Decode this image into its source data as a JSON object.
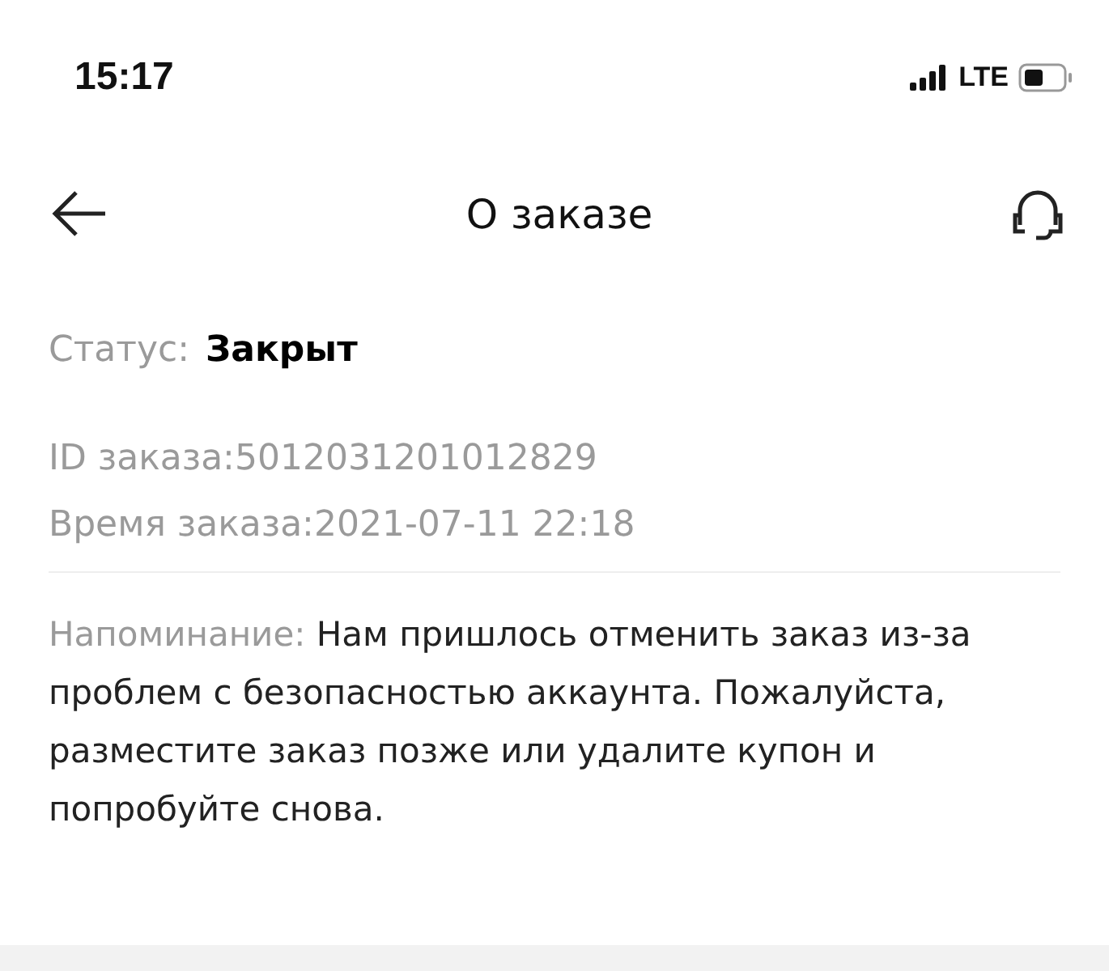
{
  "status_bar": {
    "time": "15:17",
    "network": "LTE"
  },
  "nav": {
    "title": "О заказе"
  },
  "order": {
    "status_label": "Статус:",
    "status_value": "Закрыт",
    "lines": [
      "ID заказа:5012031201012829",
      "Время заказа:2021-07-11 22:18"
    ]
  },
  "reminder": {
    "label": "Напоминание:",
    "text": "Нам пришлось отменить заказ из-за проблем с безопасностью аккаунта. Пожалуйста, разместите заказ позже или удалите купон и попробуйте снова."
  }
}
